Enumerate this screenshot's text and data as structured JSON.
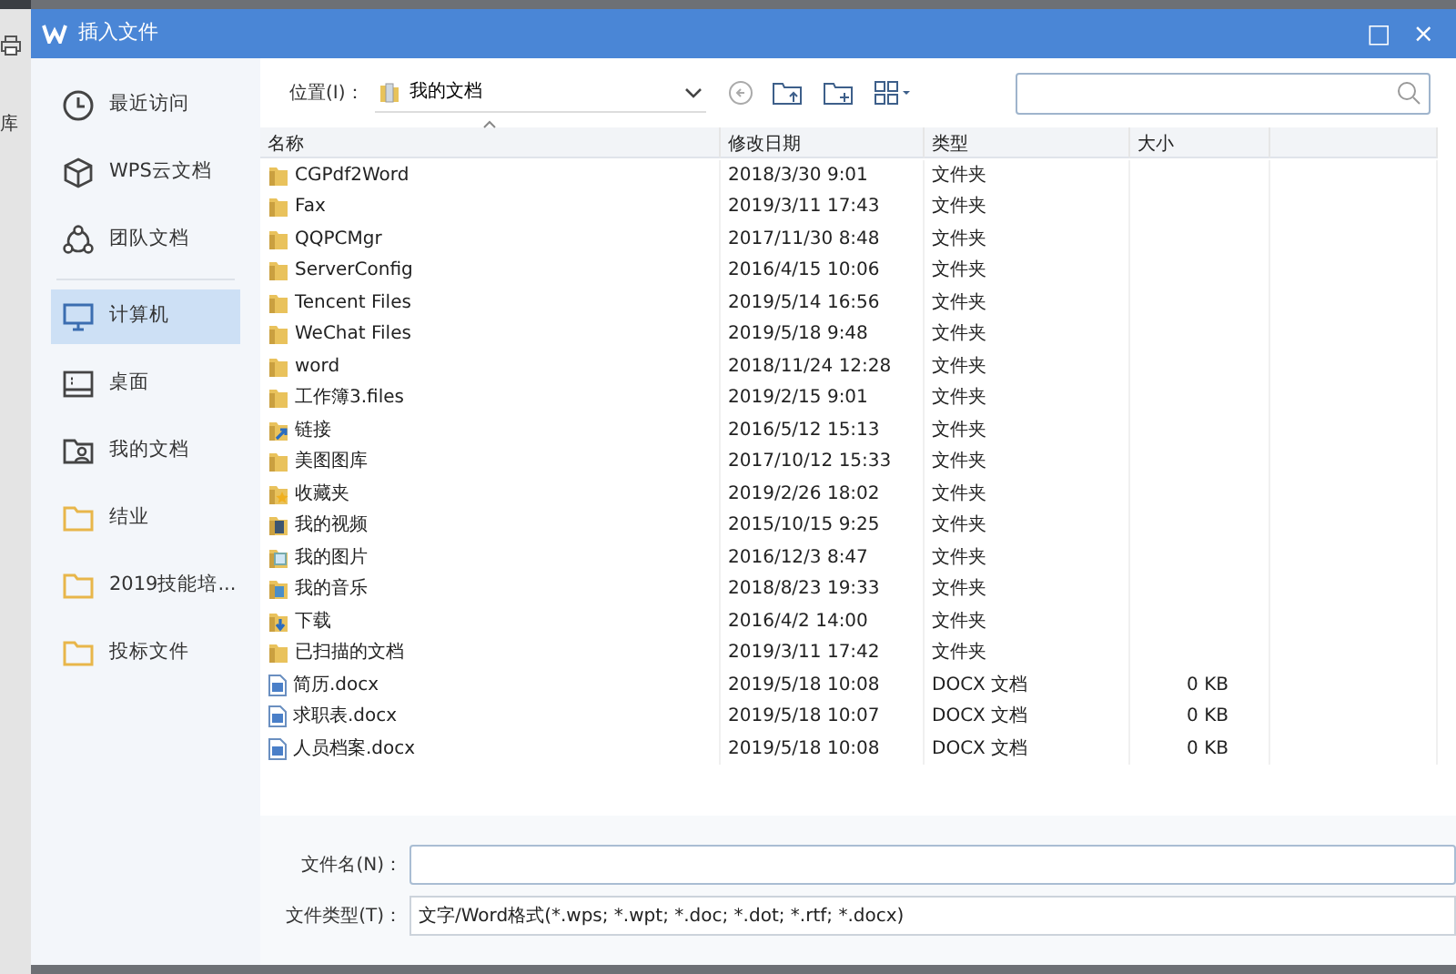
{
  "background": {
    "label": "库"
  },
  "window": {
    "title": "插入文件",
    "buttons": [
      "□",
      "×"
    ]
  },
  "sidebar": {
    "items": [
      {
        "label": "最近访问",
        "kind": "clock",
        "selected": false
      },
      {
        "label": "WPS云文档",
        "kind": "cube",
        "selected": false
      },
      {
        "label": "团队文档",
        "kind": "team",
        "selected": false
      },
      {
        "label": "计算机",
        "kind": "monitor",
        "selected": true
      },
      {
        "label": "桌面",
        "kind": "desktop",
        "selected": false
      },
      {
        "label": "我的文档",
        "kind": "userfolder",
        "selected": false
      },
      {
        "label": "结业",
        "kind": "folder",
        "selected": false
      },
      {
        "label": "2019技能培...",
        "kind": "folder",
        "selected": false
      },
      {
        "label": "投标文件",
        "kind": "folder",
        "selected": false
      }
    ]
  },
  "toolbar": {
    "location_label": "位置(I)：",
    "location": "我的文档"
  },
  "table": {
    "columns": [
      "名称",
      "修改日期",
      "类型",
      "大小"
    ],
    "rows": [
      {
        "name": "CGPdf2Word",
        "date": "2018/3/30 9:01",
        "type": "文件夹",
        "kind": "folder"
      },
      {
        "name": "Fax",
        "date": "2019/3/11 17:43",
        "type": "文件夹",
        "kind": "folder"
      },
      {
        "name": "QQPCMgr",
        "date": "2017/11/30 8:48",
        "type": "文件夹",
        "kind": "folder"
      },
      {
        "name": "ServerConfig",
        "date": "2016/4/15 10:06",
        "type": "文件夹",
        "kind": "folder"
      },
      {
        "name": "Tencent Files",
        "date": "2019/5/14 16:56",
        "type": "文件夹",
        "kind": "folder"
      },
      {
        "name": "WeChat Files",
        "date": "2019/5/18 9:48",
        "type": "文件夹",
        "kind": "folder"
      },
      {
        "name": "word",
        "date": "2018/11/24 12:28",
        "type": "文件夹",
        "kind": "folder"
      },
      {
        "name": "工作簿3.files",
        "date": "2019/2/15 9:01",
        "type": "文件夹",
        "kind": "folder"
      },
      {
        "name": "链接",
        "date": "2016/5/12 15:13",
        "type": "文件夹",
        "kind": "link"
      },
      {
        "name": "美图图库",
        "date": "2017/10/12 15:33",
        "type": "文件夹",
        "kind": "folder"
      },
      {
        "name": "收藏夹",
        "date": "2019/2/26 18:02",
        "type": "文件夹",
        "kind": "favorites"
      },
      {
        "name": "我的视频",
        "date": "2015/10/15 9:25",
        "type": "文件夹",
        "kind": "video"
      },
      {
        "name": "我的图片",
        "date": "2016/12/3 8:47",
        "type": "文件夹",
        "kind": "pictures"
      },
      {
        "name": "我的音乐",
        "date": "2018/8/23 19:33",
        "type": "文件夹",
        "kind": "music"
      },
      {
        "name": "下载",
        "date": "2016/4/2 14:00",
        "type": "文件夹",
        "kind": "download"
      },
      {
        "name": "已扫描的文档",
        "date": "2019/3/11 17:42",
        "type": "文件夹",
        "kind": "folder"
      },
      {
        "name": "简历.docx",
        "date": "2019/5/18 10:08",
        "type": "DOCX 文档",
        "size": "0 KB",
        "kind": "docx"
      },
      {
        "name": "求职表.docx",
        "date": "2019/5/18 10:07",
        "type": "DOCX 文档",
        "size": "0 KB",
        "kind": "docx"
      },
      {
        "name": "人员档案.docx",
        "date": "2019/5/18 10:08",
        "type": "DOCX 文档",
        "size": "0 KB",
        "kind": "docx"
      }
    ]
  },
  "footer": {
    "filename_label": "文件名(N)：",
    "filetype_label": "文件类型(T)：",
    "filetype": "文字/Word格式(*.wps; *.wpt; *.doc; *.dot; *.rtf; *.docx)"
  }
}
